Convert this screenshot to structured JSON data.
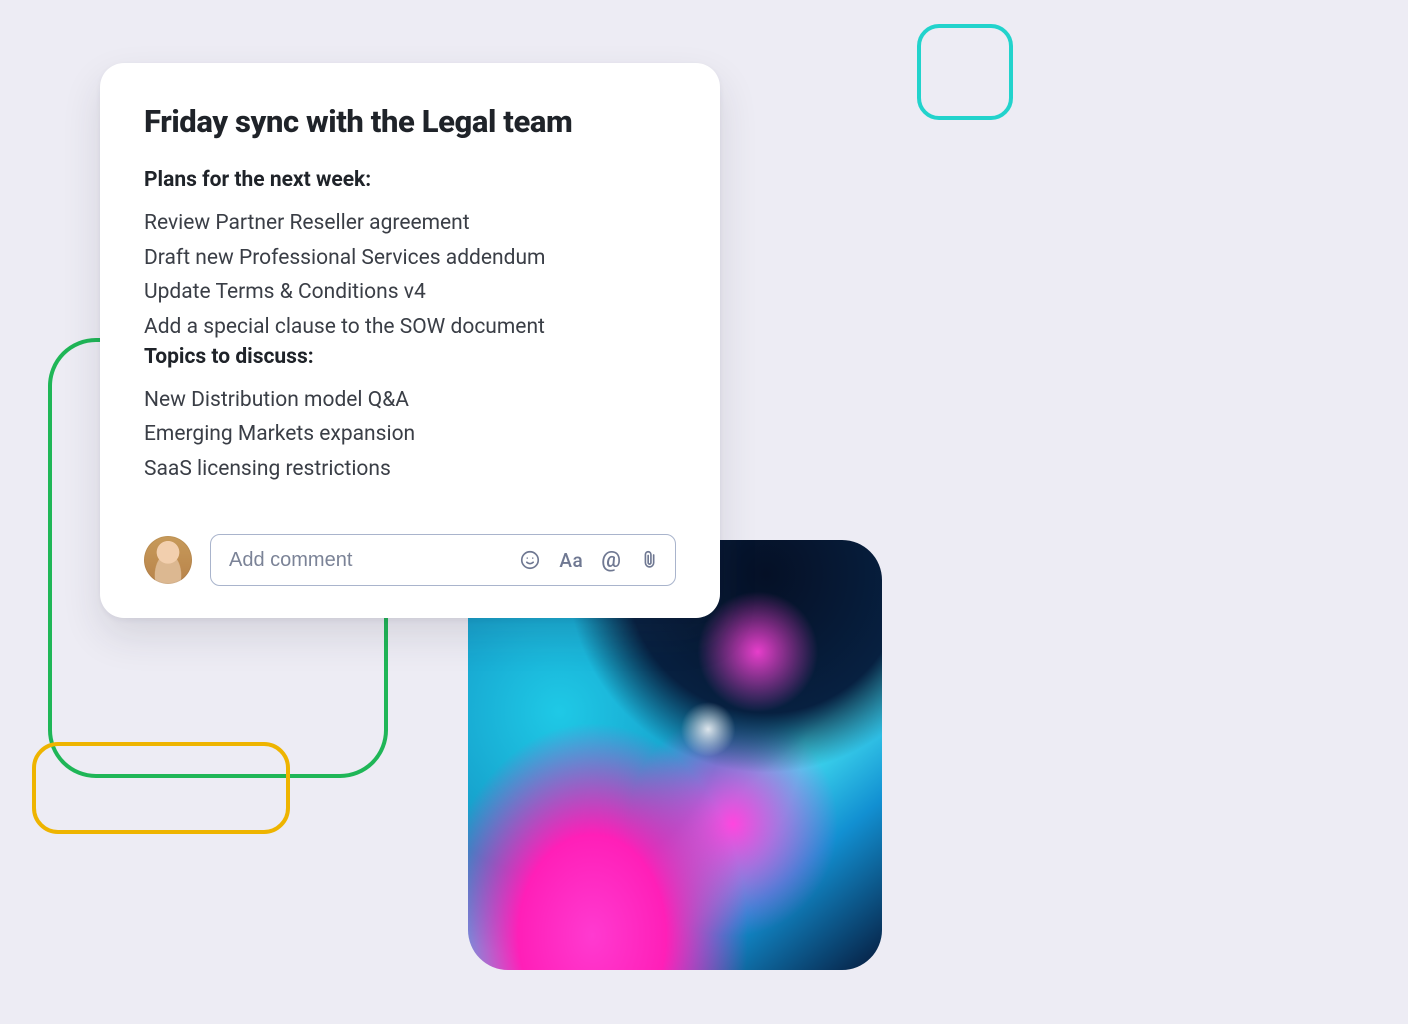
{
  "note": {
    "title": "Friday sync with the Legal team",
    "sections": [
      {
        "heading": "Plans for the next week:",
        "items": [
          "Review Partner Reseller agreement",
          "Draft new Professional Services addendum",
          "Update Terms & Conditions v4",
          "Add a special clause to the SOW document"
        ]
      },
      {
        "heading": "Topics to discuss:",
        "items": [
          "New Distribution model Q&A",
          "Emerging Markets expansion",
          "SaaS licensing restrictions"
        ]
      }
    ]
  },
  "comment": {
    "placeholder": "Add comment",
    "format_label": "Aa",
    "mention_label": "@"
  }
}
